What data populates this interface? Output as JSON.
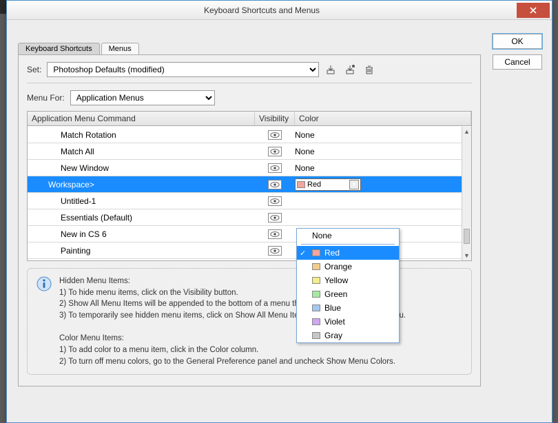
{
  "window": {
    "title": "Keyboard Shortcuts and Menus"
  },
  "buttons": {
    "ok": "OK",
    "cancel": "Cancel"
  },
  "tabs": {
    "shortcuts": "Keyboard Shortcuts",
    "menus": "Menus"
  },
  "set": {
    "label": "Set:",
    "value": "Photoshop Defaults (modified)"
  },
  "menu_for": {
    "label": "Menu For:",
    "value": "Application Menus"
  },
  "table": {
    "headers": {
      "cmd": "Application Menu Command",
      "vis": "Visibility",
      "col": "Color"
    },
    "rows": [
      {
        "cmd": "Match Rotation",
        "color": "None",
        "indent": 1,
        "selected": false
      },
      {
        "cmd": "Match All",
        "color": "None",
        "indent": 1,
        "selected": false
      },
      {
        "cmd": "New Window",
        "color": "None",
        "indent": 1,
        "selected": false
      },
      {
        "cmd": "Workspace>",
        "color": "Red",
        "indent": 0,
        "selected": true
      },
      {
        "cmd": "Untitled-1",
        "color": "",
        "indent": 1,
        "selected": false
      },
      {
        "cmd": "Essentials (Default)",
        "color": "",
        "indent": 1,
        "selected": false
      },
      {
        "cmd": "New in CS 6",
        "color": "",
        "indent": 1,
        "selected": false
      },
      {
        "cmd": "Painting",
        "color": "",
        "indent": 1,
        "selected": false
      }
    ]
  },
  "color_dropdown": {
    "none": "None",
    "options": [
      {
        "label": "Red",
        "hex": "#f2a6a0",
        "selected": true
      },
      {
        "label": "Orange",
        "hex": "#f2cc8b",
        "selected": false
      },
      {
        "label": "Yellow",
        "hex": "#f2ee8b",
        "selected": false
      },
      {
        "label": "Green",
        "hex": "#a7e9a3",
        "selected": false
      },
      {
        "label": "Blue",
        "hex": "#a3c8f0",
        "selected": false
      },
      {
        "label": "Violet",
        "hex": "#cfa8ee",
        "selected": false
      },
      {
        "label": "Gray",
        "hex": "#c7c7c7",
        "selected": false
      }
    ]
  },
  "hints": {
    "hidden_title": "Hidden Menu Items:",
    "hidden_1": "1) To hide menu items, click on the Visibility button.",
    "hidden_2": "2) Show All Menu Items will be appended to the bottom of a menu that contains hidden items.",
    "hidden_3": "3) To temporarily see hidden menu items, click on Show All Menu Items or Ctrl + click on the menu.",
    "color_title": "Color Menu Items:",
    "color_1": "1) To add color to a menu item, click in the Color column.",
    "color_2": "2) To turn off menu colors, go to the General Preference panel and uncheck Show Menu Colors."
  },
  "icons": {
    "save": "save-set-icon",
    "save_as": "save-set-as-icon",
    "trash": "delete-set-icon"
  }
}
